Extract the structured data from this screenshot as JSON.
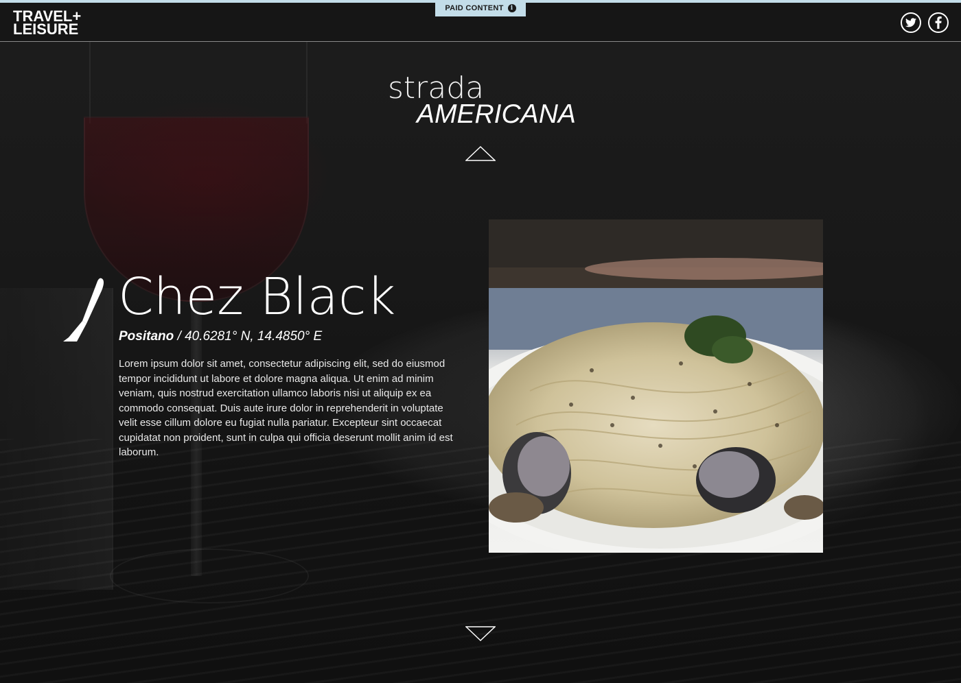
{
  "header": {
    "logo_line1": "TRAVEL+",
    "logo_line2": "LEISURE",
    "paid_badge_label": "PAID CONTENT",
    "paid_badge_icon": "info-icon",
    "social": [
      {
        "name": "twitter",
        "icon": "twitter-icon"
      },
      {
        "name": "facebook",
        "icon": "facebook-icon"
      }
    ],
    "accent_color": "#c3dde9"
  },
  "section": {
    "title_small": "strada",
    "title_big": "AMERICANA",
    "nav_up_icon": "triangle-up-icon",
    "nav_down_icon": "triangle-down-icon"
  },
  "restaurant": {
    "icon": "knife-icon",
    "name": "Chez Black",
    "place": "Positano",
    "coordinates": " / 40.6281° N, 14.4850° E",
    "description": "Lorem ipsum dolor sit amet, consectetur adipiscing elit, sed do eiusmod tempor incididunt ut labore et dolore magna aliqua. Ut enim ad minim veniam, quis nostrud exercitation ullamco laboris nisi ut aliquip ex ea commodo consequat. Duis aute irure dolor in reprehenderit in voluptate velit esse cillum dolore eu fugiat nulla pariatur. Excepteur sint occaecat cupidatat non proident, sunt in culpa qui officia deserunt mollit anim id est laborum."
  }
}
